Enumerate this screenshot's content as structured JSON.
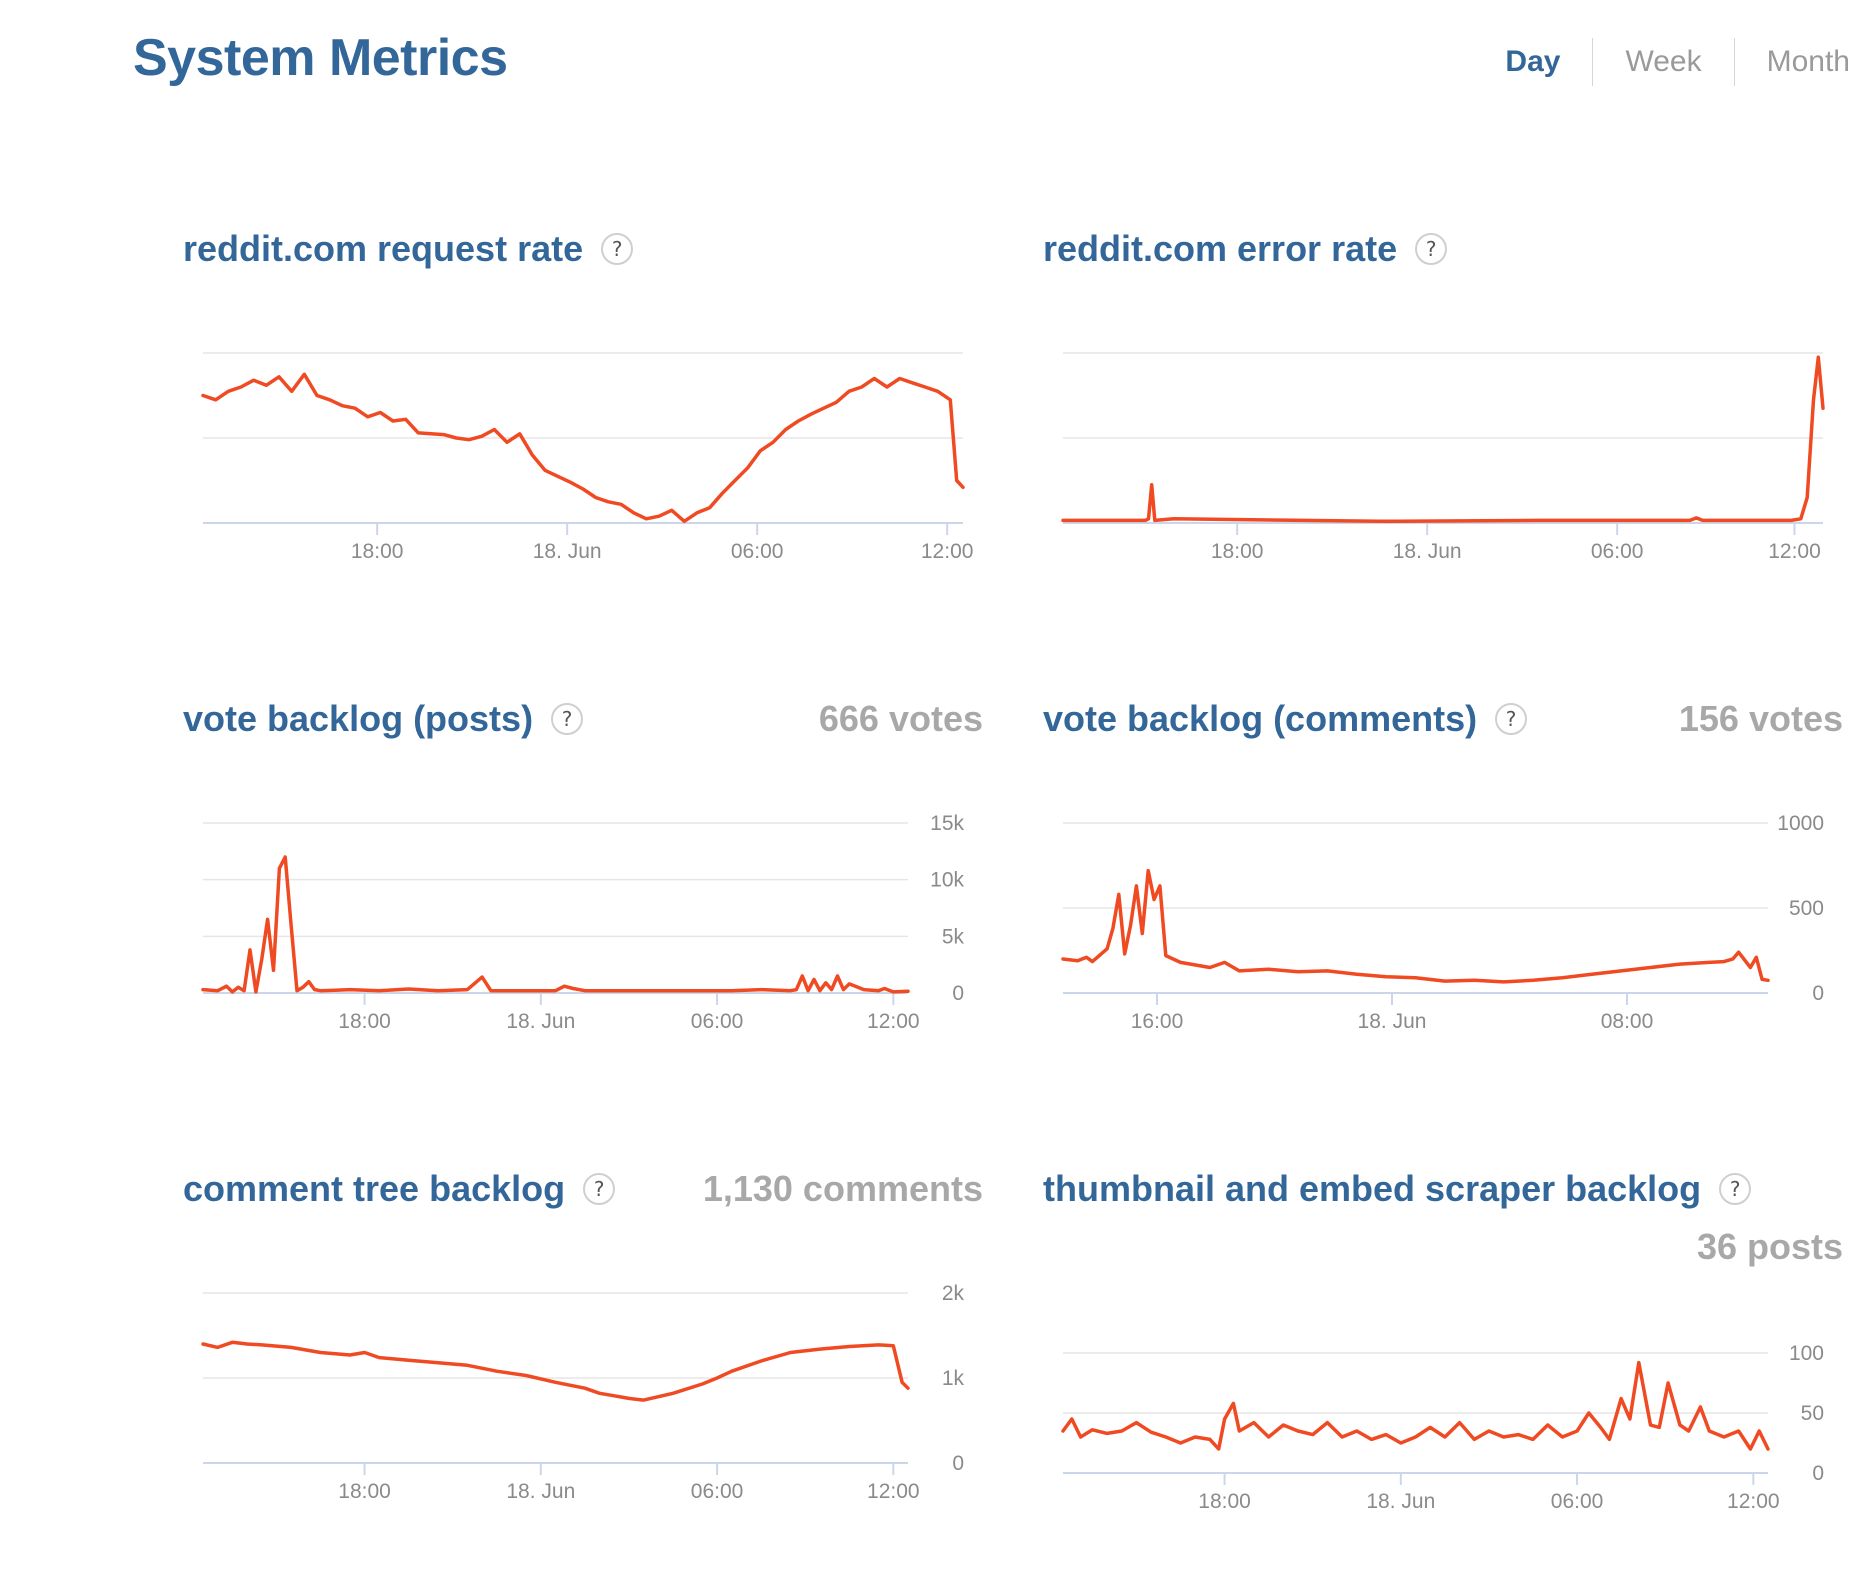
{
  "page": {
    "title": "System Metrics",
    "ranges": [
      "Day",
      "Week",
      "Month"
    ],
    "active_range": "Day"
  },
  "colors": {
    "line": "#f04a23",
    "title": "#336699",
    "grid": "#e6e6e6",
    "axis": "#ccd6eb",
    "muted": "#a8a8a8"
  },
  "icons": {
    "help": "question-mark-icon"
  },
  "panels": [
    {
      "id": "request-rate",
      "title": "reddit.com request rate",
      "help": "?",
      "stat": ""
    },
    {
      "id": "error-rate",
      "title": "reddit.com error rate",
      "help": "?",
      "stat": ""
    },
    {
      "id": "vote-backlog-posts",
      "title": "vote backlog (posts)",
      "help": "?",
      "stat": "666 votes"
    },
    {
      "id": "vote-backlog-comments",
      "title": "vote backlog (comments)",
      "help": "?",
      "stat": "156 votes"
    },
    {
      "id": "comment-tree-backlog",
      "title": "comment tree backlog",
      "help": "?",
      "stat": "1,130 comments"
    },
    {
      "id": "scraper-backlog",
      "title": "thumbnail and embed scraper backlog",
      "help": "?",
      "stat": "36 posts"
    }
  ],
  "chart_data": [
    {
      "id": "request-rate",
      "type": "line",
      "y_axis": "hidden",
      "grid": true,
      "x_ticks": [
        {
          "label": "18:00",
          "at": 5.5
        },
        {
          "label": "18. Jun",
          "at": 11.5
        },
        {
          "label": "06:00",
          "at": 17.5
        },
        {
          "label": "12:00",
          "at": 23.5
        }
      ],
      "xlim": [
        0,
        24
      ],
      "ylim": [
        0,
        2
      ],
      "x": [
        0,
        0.4,
        0.8,
        1.2,
        1.6,
        2.0,
        2.4,
        2.8,
        3.2,
        3.6,
        4.0,
        4.4,
        4.8,
        5.2,
        5.6,
        6.0,
        6.4,
        6.8,
        7.2,
        7.6,
        8.0,
        8.4,
        8.8,
        9.2,
        9.6,
        10.0,
        10.4,
        10.8,
        11.2,
        11.6,
        12.0,
        12.4,
        12.8,
        13.2,
        13.6,
        14.0,
        14.4,
        14.8,
        15.2,
        15.6,
        16.0,
        16.4,
        16.8,
        17.2,
        17.6,
        18.0,
        18.4,
        18.8,
        19.2,
        19.6,
        20.0,
        20.4,
        20.8,
        21.2,
        21.6,
        22.0,
        22.4,
        22.8,
        23.2,
        23.6,
        23.8,
        24.0
      ],
      "values": [
        1.5,
        1.45,
        1.55,
        1.6,
        1.68,
        1.62,
        1.72,
        1.55,
        1.75,
        1.5,
        1.45,
        1.38,
        1.35,
        1.25,
        1.3,
        1.2,
        1.22,
        1.06,
        1.05,
        1.04,
        1.0,
        0.98,
        1.02,
        1.1,
        0.95,
        1.05,
        0.8,
        0.62,
        0.55,
        0.48,
        0.4,
        0.3,
        0.25,
        0.22,
        0.12,
        0.05,
        0.08,
        0.15,
        0.02,
        0.12,
        0.18,
        0.35,
        0.5,
        0.65,
        0.85,
        0.95,
        1.1,
        1.2,
        1.28,
        1.35,
        1.42,
        1.55,
        1.6,
        1.7,
        1.6,
        1.7,
        1.65,
        1.6,
        1.55,
        1.45,
        0.5,
        0.42
      ]
    },
    {
      "id": "error-rate",
      "type": "line",
      "y_axis": "hidden",
      "grid": true,
      "x_ticks": [
        {
          "label": "18:00",
          "at": 5.5
        },
        {
          "label": "18. Jun",
          "at": 11.5
        },
        {
          "label": "06:00",
          "at": 17.5
        },
        {
          "label": "12:00",
          "at": 23.1
        }
      ],
      "xlim": [
        0,
        24
      ],
      "ylim": [
        0,
        2
      ],
      "x": [
        0,
        2.6,
        2.7,
        2.8,
        2.9,
        3.5,
        10,
        15,
        19,
        19.8,
        20,
        20.2,
        23,
        23.3,
        23.5,
        23.7,
        23.85,
        24.0
      ],
      "values": [
        0.03,
        0.03,
        0.05,
        0.45,
        0.03,
        0.05,
        0.02,
        0.03,
        0.03,
        0.03,
        0.06,
        0.03,
        0.03,
        0.05,
        0.3,
        1.45,
        1.95,
        1.35
      ]
    },
    {
      "id": "vote-backlog-posts",
      "type": "line",
      "y_axis": "right",
      "grid": true,
      "y_ticks": [
        {
          "label": "0",
          "at": 0
        },
        {
          "label": "5k",
          "at": 5000
        },
        {
          "label": "10k",
          "at": 10000
        },
        {
          "label": "15k",
          "at": 15000
        }
      ],
      "x_ticks": [
        {
          "label": "18:00",
          "at": 5.5
        },
        {
          "label": "18. Jun",
          "at": 11.5
        },
        {
          "label": "06:00",
          "at": 17.5
        },
        {
          "label": "12:00",
          "at": 23.5
        }
      ],
      "xlim": [
        0,
        24
      ],
      "ylim": [
        0,
        15000
      ],
      "x": [
        0,
        0.5,
        0.8,
        1.0,
        1.2,
        1.4,
        1.6,
        1.8,
        2.0,
        2.2,
        2.4,
        2.6,
        2.8,
        3.0,
        3.2,
        3.4,
        3.6,
        3.8,
        4.0,
        4.5,
        5.0,
        6.0,
        7.0,
        8.0,
        9.0,
        9.5,
        9.8,
        10.0,
        11.0,
        12.0,
        12.3,
        12.6,
        13.0,
        15.0,
        17.0,
        18.0,
        19.0,
        20.0,
        20.2,
        20.4,
        20.6,
        20.8,
        21.0,
        21.2,
        21.4,
        21.6,
        21.8,
        22.0,
        22.5,
        23.0,
        23.2,
        23.5,
        24.0
      ],
      "values": [
        300,
        200,
        600,
        100,
        500,
        200,
        3800,
        100,
        3000,
        6500,
        2000,
        11000,
        12000,
        6000,
        200,
        500,
        1000,
        300,
        200,
        250,
        300,
        200,
        350,
        200,
        300,
        1400,
        200,
        200,
        200,
        200,
        600,
        400,
        200,
        200,
        200,
        200,
        300,
        200,
        300,
        1500,
        200,
        1200,
        200,
        900,
        300,
        1500,
        300,
        800,
        300,
        200,
        400,
        100,
        150
      ]
    },
    {
      "id": "vote-backlog-comments",
      "type": "line",
      "y_axis": "right",
      "grid": true,
      "y_ticks": [
        {
          "label": "0",
          "at": 0
        },
        {
          "label": "500",
          "at": 500
        },
        {
          "label": "1000",
          "at": 1000
        }
      ],
      "x_ticks": [
        {
          "label": "16:00",
          "at": 3.2
        },
        {
          "label": "18. Jun",
          "at": 11.2
        },
        {
          "label": "08:00",
          "at": 19.2
        }
      ],
      "xlim": [
        0,
        24
      ],
      "ylim": [
        0,
        1000
      ],
      "x": [
        0,
        0.5,
        0.8,
        1.0,
        1.3,
        1.5,
        1.7,
        1.9,
        2.1,
        2.3,
        2.5,
        2.7,
        2.9,
        3.1,
        3.3,
        3.5,
        4.0,
        5.0,
        5.5,
        6.0,
        7.0,
        8.0,
        9.0,
        10.0,
        11.0,
        12.0,
        13.0,
        14.0,
        15.0,
        16.0,
        17.0,
        18.0,
        19.0,
        20.0,
        21.0,
        22.0,
        22.5,
        22.8,
        23.0,
        23.4,
        23.6,
        23.8,
        24.0
      ],
      "values": [
        200,
        190,
        210,
        185,
        230,
        260,
        380,
        580,
        230,
        400,
        630,
        350,
        720,
        550,
        630,
        220,
        180,
        150,
        180,
        130,
        140,
        125,
        130,
        110,
        95,
        90,
        70,
        75,
        65,
        75,
        90,
        110,
        130,
        150,
        170,
        180,
        185,
        200,
        240,
        150,
        210,
        80,
        75
      ]
    },
    {
      "id": "comment-tree-backlog",
      "type": "line",
      "y_axis": "right",
      "grid": true,
      "y_ticks": [
        {
          "label": "0",
          "at": 0
        },
        {
          "label": "1k",
          "at": 1000
        },
        {
          "label": "2k",
          "at": 2000
        }
      ],
      "x_ticks": [
        {
          "label": "18:00",
          "at": 5.5
        },
        {
          "label": "18. Jun",
          "at": 11.5
        },
        {
          "label": "06:00",
          "at": 17.5
        },
        {
          "label": "12:00",
          "at": 23.5
        }
      ],
      "xlim": [
        0,
        24
      ],
      "ylim": [
        0,
        2000
      ],
      "x": [
        0,
        0.5,
        1.0,
        1.5,
        2.0,
        3.0,
        4.0,
        5.0,
        5.5,
        6.0,
        7.0,
        8.0,
        9.0,
        10.0,
        11.0,
        12.0,
        13.0,
        13.5,
        14.0,
        14.5,
        15.0,
        16.0,
        17.0,
        17.5,
        18.0,
        19.0,
        20.0,
        21.0,
        22.0,
        23.0,
        23.5,
        23.8,
        24.0
      ],
      "values": [
        1400,
        1360,
        1420,
        1400,
        1390,
        1360,
        1300,
        1270,
        1300,
        1240,
        1210,
        1180,
        1150,
        1080,
        1030,
        950,
        880,
        820,
        790,
        760,
        740,
        820,
        930,
        1000,
        1080,
        1200,
        1300,
        1340,
        1370,
        1390,
        1380,
        950,
        880
      ]
    },
    {
      "id": "scraper-backlog",
      "type": "line",
      "y_axis": "right",
      "grid": true,
      "y_ticks": [
        {
          "label": "0",
          "at": 0
        },
        {
          "label": "50",
          "at": 50
        },
        {
          "label": "100",
          "at": 100
        }
      ],
      "x_ticks": [
        {
          "label": "18:00",
          "at": 5.5
        },
        {
          "label": "18. Jun",
          "at": 11.5
        },
        {
          "label": "06:00",
          "at": 17.5
        },
        {
          "label": "12:00",
          "at": 23.5
        }
      ],
      "xlim": [
        0,
        24
      ],
      "ylim": [
        0,
        100
      ],
      "x": [
        0,
        0.3,
        0.6,
        1.0,
        1.5,
        2.0,
        2.5,
        3.0,
        3.5,
        4.0,
        4.5,
        5.0,
        5.3,
        5.5,
        5.8,
        6.0,
        6.5,
        7.0,
        7.5,
        8.0,
        8.5,
        9.0,
        9.5,
        10.0,
        10.5,
        11.0,
        11.5,
        12.0,
        12.5,
        13.0,
        13.5,
        14.0,
        14.5,
        15.0,
        15.5,
        16.0,
        16.5,
        17.0,
        17.5,
        17.9,
        18.3,
        18.6,
        19.0,
        19.3,
        19.6,
        20.0,
        20.3,
        20.6,
        21.0,
        21.3,
        21.7,
        22.0,
        22.5,
        23.0,
        23.4,
        23.7,
        24.0
      ],
      "values": [
        35,
        45,
        30,
        36,
        33,
        35,
        42,
        34,
        30,
        25,
        30,
        28,
        20,
        45,
        58,
        35,
        42,
        30,
        40,
        35,
        32,
        42,
        30,
        35,
        28,
        32,
        25,
        30,
        38,
        30,
        42,
        28,
        35,
        30,
        32,
        28,
        40,
        30,
        35,
        50,
        38,
        28,
        62,
        45,
        92,
        40,
        38,
        75,
        40,
        35,
        55,
        35,
        30,
        35,
        20,
        35,
        20
      ]
    }
  ]
}
